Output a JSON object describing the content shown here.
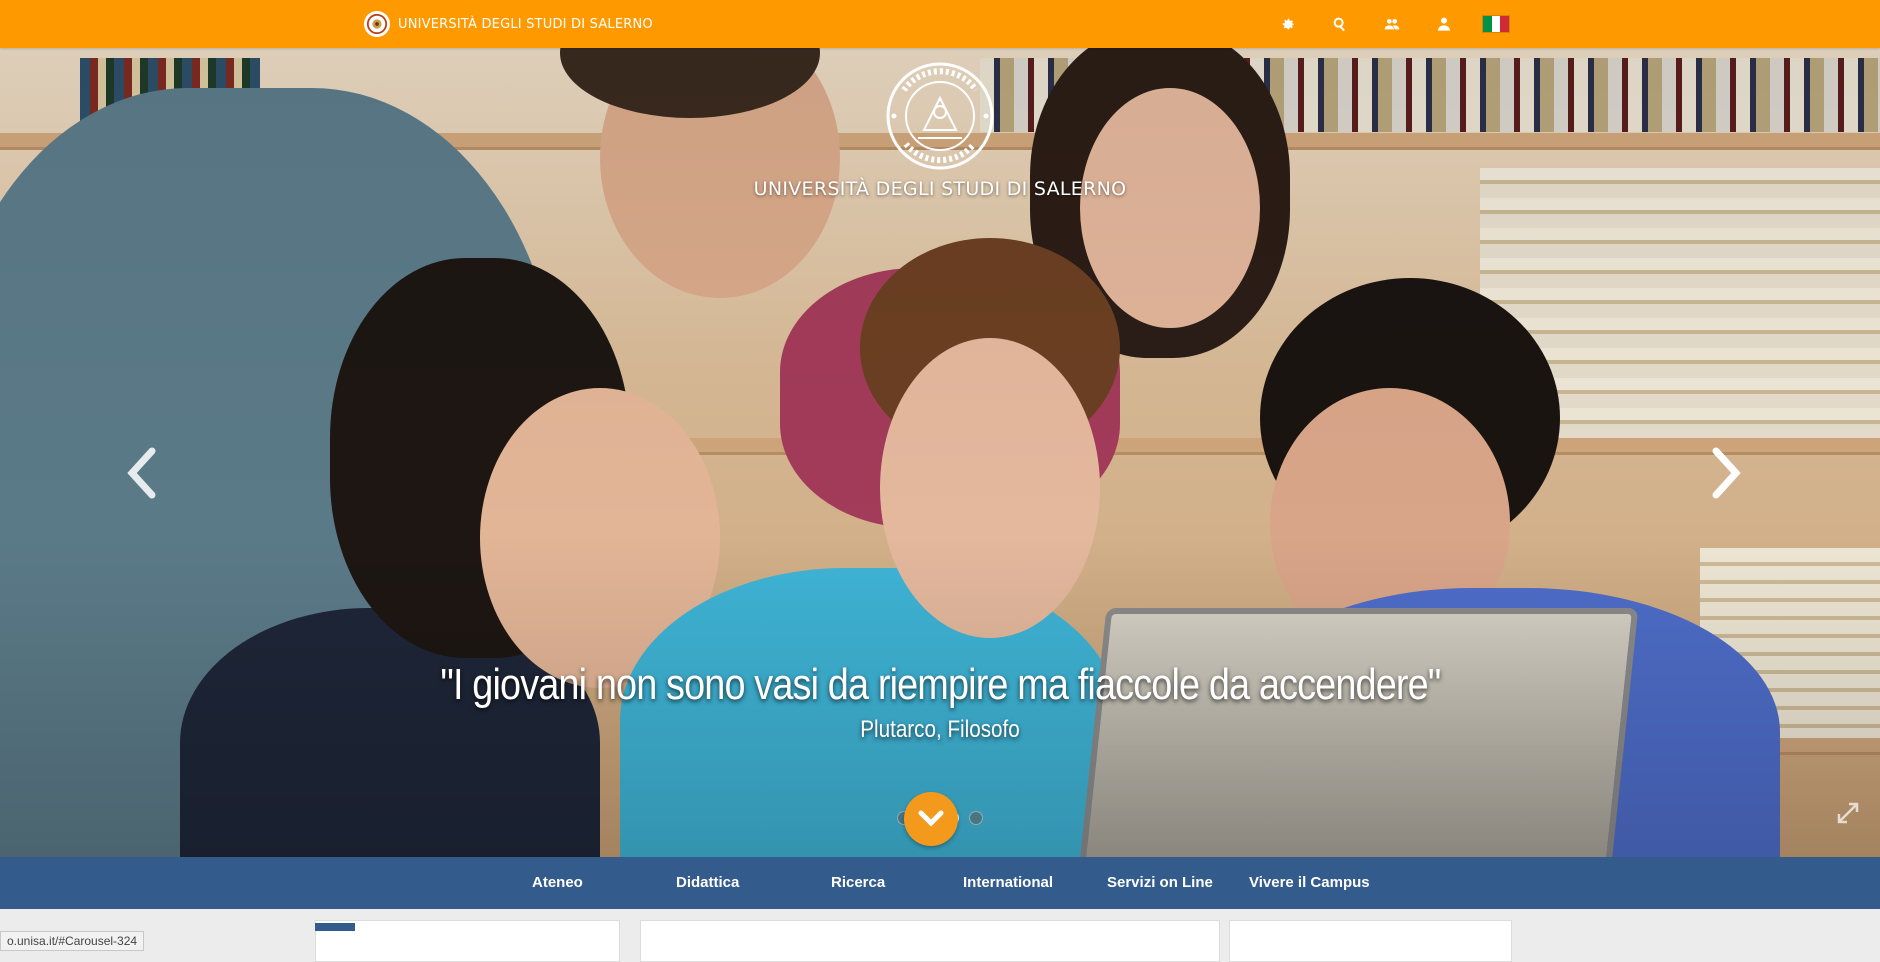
{
  "header": {
    "brand_name": "UNIVERSITÀ DEGLI STUDI DI SALERNO",
    "icons": [
      "gear-icon",
      "search-icon",
      "users-icon",
      "user-icon",
      "italian-flag-icon"
    ],
    "colors": {
      "bar": "#ff9900",
      "flag_green": "#009246",
      "flag_white": "#ffffff",
      "flag_red": "#ce2b37"
    }
  },
  "hero": {
    "title": "UNIVERSITÀ DEGLI STUDI DI SALERNO",
    "quote": "\"I giovani non sono vasi da riempire ma fiaccole da accendere\"",
    "author": "Plutarco, Filosofo",
    "slides": 4,
    "active_slide": 3,
    "scroll_button_color": "#f39a1c"
  },
  "nav": {
    "items": [
      "Ateneo",
      "Didattica",
      "Ricerca",
      "International",
      "Servizi on Line",
      "Vivere il Campus"
    ],
    "color": "#335b8c"
  },
  "status_bar": {
    "url": "o.unisa.it/#Carousel-324"
  }
}
